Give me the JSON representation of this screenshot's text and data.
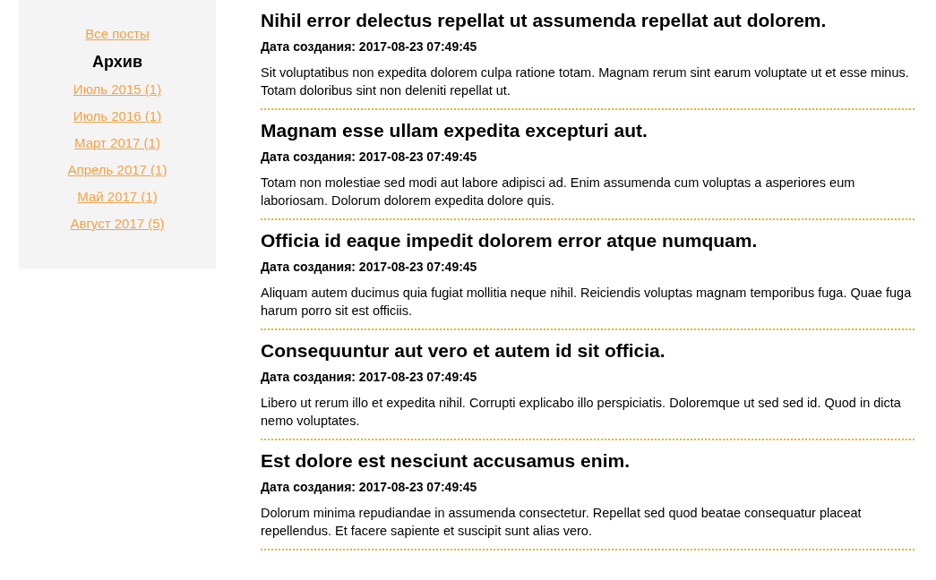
{
  "sidebar": {
    "all_posts": "Все посты",
    "archive_title": "Архив",
    "archive": [
      {
        "label": "Июль 2015 (1)"
      },
      {
        "label": "Июль 2016 (1)"
      },
      {
        "label": "Март 2017 (1)"
      },
      {
        "label": "Апрель 2017 (1)"
      },
      {
        "label": "Май 2017 (1)"
      },
      {
        "label": "Август 2017 (5)"
      }
    ]
  },
  "posts": [
    {
      "title": "Nihil error delectus repellat ut assumenda repellat aut dolorem.",
      "date": "Дата создания: 2017-08-23 07:49:45",
      "text": "Sit voluptatibus non expedita dolorem culpa ratione totam. Magnam rerum sint earum voluptate ut et esse minus. Totam doloribus sint non deleniti repellat ut."
    },
    {
      "title": "Magnam esse ullam expedita excepturi aut.",
      "date": "Дата создания: 2017-08-23 07:49:45",
      "text": "Totam non molestiae sed modi aut labore adipisci ad. Enim assumenda cum voluptas a asperiores eum laboriosam. Dolorum dolorem expedita dolore quis."
    },
    {
      "title": "Officia id eaque impedit dolorem error atque numquam.",
      "date": "Дата создания: 2017-08-23 07:49:45",
      "text": "Aliquam autem ducimus quia fugiat mollitia neque nihil. Reiciendis voluptas magnam temporibus fuga. Quae fuga harum porro sit est officiis."
    },
    {
      "title": "Consequuntur aut vero et autem id sit officia.",
      "date": "Дата создания: 2017-08-23 07:49:45",
      "text": "Libero ut rerum illo et expedita nihil. Corrupti explicabo illo perspiciatis. Doloremque ut sed sed id. Quod in dicta nemo voluptates."
    },
    {
      "title": "Est dolore est nesciunt accusamus enim.",
      "date": "Дата создания: 2017-08-23 07:49:45",
      "text": "Dolorum minima repudiandae in assumenda consectetur. Repellat sed quod beatae consequatur placeat repellendus. Et facere sapiente et suscipit sunt alias vero."
    }
  ]
}
